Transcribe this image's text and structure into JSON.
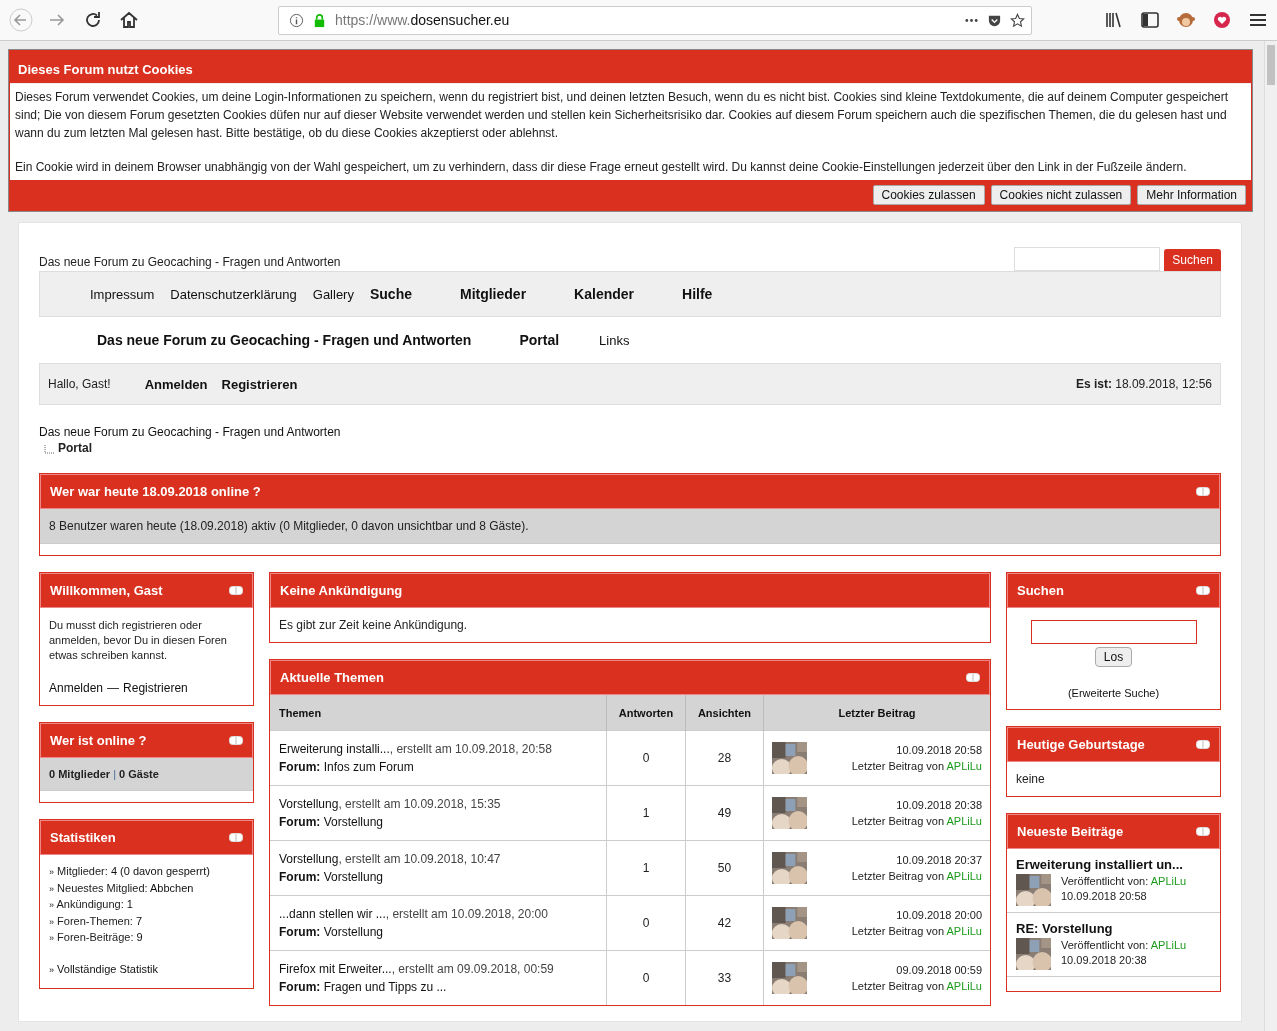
{
  "browser": {
    "url_scheme": "https://www.",
    "url_host": "dosensucher.eu"
  },
  "cookie_notice": {
    "title": "Dieses Forum nutzt Cookies",
    "paragraphs": [
      "Dieses Forum verwendet Cookies, um deine Login-Informationen zu speichern, wenn du registriert bist, und deinen letzten Besuch, wenn du es nicht bist. Cookies sind kleine Textdokumente, die auf deinem Computer gespeichert sind; Die von diesem Forum gesetzten Cookies düfen nur auf dieser Website verwendet werden und stellen kein Sicherheitsrisiko dar. Cookies auf diesem Forum speichern auch die spezifischen Themen, die du gelesen hast und wann du zum letzten Mal gelesen hast. Bitte bestätige, ob du diese Cookies akzeptierst oder ablehnst.",
      "Ein Cookie wird in deinem Browser unabhängig von der Wahl gespeichert, um zu verhindern, dass dir diese Frage erneut gestellt wird. Du kannst deine Cookie-Einstellungen jederzeit über den Link in der Fußzeile ändern."
    ],
    "buttons": [
      "Cookies zulassen",
      "Cookies nicht zulassen",
      "Mehr Information"
    ]
  },
  "header": {
    "site_title": "Das neue Forum zu Geocaching - Fragen und Antworten",
    "search_button": "Suchen",
    "nav": [
      {
        "label": "Impressum",
        "bold": false
      },
      {
        "label": "Datenschutzerklärung",
        "bold": false
      },
      {
        "label": "Gallery",
        "bold": false
      },
      {
        "label": "Suche",
        "bold": true
      },
      {
        "label": "Mitglieder",
        "bold": true
      },
      {
        "label": "Kalender",
        "bold": true
      },
      {
        "label": "Hilfe",
        "bold": true
      }
    ],
    "subnav": [
      {
        "label": "Das neue Forum zu Geocaching - Fragen und Antworten",
        "bold": true
      },
      {
        "label": "Portal",
        "bold": true
      },
      {
        "label": "Links",
        "bold": false
      }
    ]
  },
  "user_bar": {
    "greeting": "Hallo, Gast!",
    "links": [
      "Anmelden",
      "Registrieren"
    ],
    "time": "**Es ist:** 18.09.2018, 12:56"
  },
  "breadcrumb": {
    "root": "Das neue Forum zu Geocaching - Fragen und Antworten",
    "current": "Portal"
  },
  "online_today": {
    "title": "Wer war heute 18.09.2018 online ?",
    "text": "8 Benutzer waren heute (18.09.2018) aktiv (0 Mitglieder, 0 davon unsichtbar und 8 Gäste)."
  },
  "welcome": {
    "title": "Willkommen, Gast",
    "text": "Du musst dich registrieren oder anmelden, bevor Du in diesen Foren etwas schreiben kannst.",
    "login": "Anmelden",
    "separator": "—",
    "register": "Registrieren"
  },
  "who_online": {
    "title": "Wer ist online ?",
    "members": "0 Mitglieder",
    "separator": "|",
    "guests": "0 Gäste"
  },
  "statistics": {
    "title": "Statistiken",
    "items": [
      {
        "label": "Mitglieder:",
        "value": "4 (0 davon gesperrt)"
      },
      {
        "label": "Neuestes Mitglied:",
        "value": "Abbchen"
      },
      {
        "label": "Ankündigung:",
        "value": "1"
      },
      {
        "label": "Foren-Themen:",
        "value": "7"
      },
      {
        "label": "Foren-Beiträge:",
        "value": "9"
      }
    ],
    "full_link": "Vollständige Statistik",
    "bullet": "»"
  },
  "announcement": {
    "title": "Keine Ankündigung",
    "text": "Es gibt zur Zeit keine Ankündigung."
  },
  "recent_topics": {
    "title": "Aktuelle Themen",
    "columns": [
      "Themen",
      "Antworten",
      "Ansichten",
      "Letzter Beitrag"
    ],
    "rows": [
      {
        "topic": "Erweiterung installi...",
        "created": ", erstellt am 10.09.2018, 20:58",
        "forum_label": "Forum:",
        "by_label": "Letzter Beitrag von",
        "forum": "Infos zum Forum",
        "replies": "0",
        "views": "28",
        "last_date": "10.09.2018 20:58",
        "last_user": "APLiLu"
      },
      {
        "topic": "Vorstellung",
        "created": ", erstellt am 10.09.2018, 15:35",
        "forum_label": "Forum:",
        "by_label": "Letzter Beitrag von",
        "forum": "Vorstellung",
        "replies": "1",
        "views": "49",
        "last_date": "10.09.2018 20:38",
        "last_user": "APLiLu"
      },
      {
        "topic": "Vorstellung",
        "created": ", erstellt am 10.09.2018, 10:47",
        "forum_label": "Forum:",
        "by_label": "Letzter Beitrag von",
        "forum": "Vorstellung",
        "replies": "1",
        "views": "50",
        "last_date": "10.09.2018 20:37",
        "last_user": "APLiLu"
      },
      {
        "topic": "...dann stellen wir ...",
        "created": ", erstellt am 10.09.2018, 20:00",
        "forum_label": "Forum:",
        "by_label": "Letzter Beitrag von",
        "forum": "Vorstellung",
        "replies": "0",
        "views": "42",
        "last_date": "10.09.2018 20:00",
        "last_user": "APLiLu"
      },
      {
        "topic": "Firefox mit Erweiter...",
        "created": ", erstellt am 09.09.2018, 00:59",
        "forum_label": "Forum:",
        "by_label": "Letzter Beitrag von",
        "forum": "Fragen und Tipps zu ...",
        "replies": "0",
        "views": "33",
        "last_date": "09.09.2018 00:59",
        "last_user": "APLiLu"
      }
    ]
  },
  "side_search": {
    "title": "Suchen",
    "button": "Los",
    "advanced": "(Erweiterte Suche)"
  },
  "birthdays": {
    "title": "Heutige Geburtstage",
    "text": "keine"
  },
  "latest_posts": {
    "title": "Neueste Beiträge",
    "items": [
      {
        "title": "Erweiterung installiert un...",
        "by_label": "Veröffentlicht von:",
        "user": "APLiLu",
        "date": "10.09.2018 20:58"
      },
      {
        "title": "RE: Vorstellung",
        "by_label": "Veröffentlicht von:",
        "user": "APLiLu",
        "date": "10.09.2018 20:38"
      }
    ]
  }
}
